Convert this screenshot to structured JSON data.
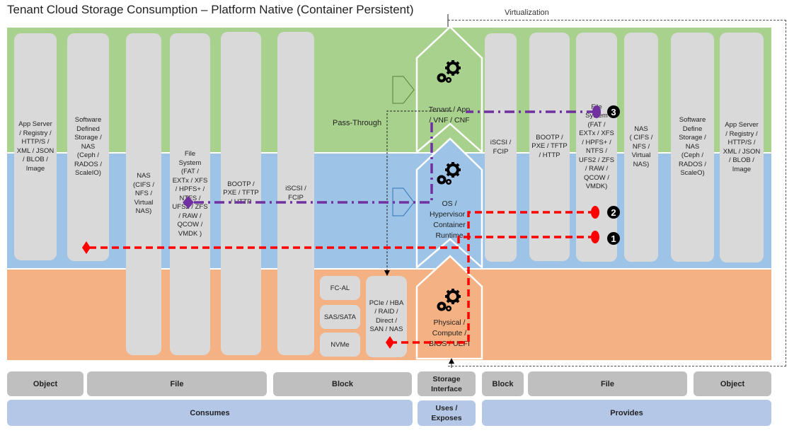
{
  "title": "Tenant Cloud Storage Consumption – Platform Native (Container Persistent)",
  "virtualization_label": "Virtualization",
  "pass_through_label": "Pass-Through",
  "colors": {
    "tenant_layer": "#a9d18e",
    "os_layer": "#9dc3e6",
    "physical_layer": "#f4b183",
    "column": "#d9d9d9",
    "category_button": "#bfbfbf",
    "role_button": "#b4c7e7",
    "path_red": "#ff0000",
    "path_purple": "#7030a0"
  },
  "left_columns": [
    {
      "label": "App Server\n/ Registry /\nHTTP/S /\nXML / JSON\n/ BLOB /\nImage"
    },
    {
      "label": "Software\nDefined\nStorage /\nNAS\n(Ceph /\nRADOS /\nScaleIO)"
    },
    {
      "label": "NAS\n(CIFS /\nNFS /\nVirtual\nNAS)"
    },
    {
      "label": "File\nSystem\n(FAT /\nEXTx / XFS\n/ HPFS+ /\nNTFS /\nUFS2 / ZFS\n/ RAW /\nQCOW /\nVMDK )"
    },
    {
      "label": "BOOTP /\nPXE / TFTP\n/ HTTP"
    },
    {
      "label": "iSCSI /\nFCIP"
    }
  ],
  "physical_interfaces": [
    {
      "label": "FC-AL"
    },
    {
      "label": "SAS/SATA"
    },
    {
      "label": "NVMe"
    }
  ],
  "physical_bus": {
    "label": "PCIe / HBA\n/ RAID /\nDirect /\nSAN / NAS"
  },
  "stack": [
    {
      "label": "Tenant / App\n/ VNF / CNF",
      "icon": "gears-icon"
    },
    {
      "label": "OS /\nHypervisor /\nContainer\nRuntime",
      "icon": "gears-icon"
    },
    {
      "label": "Physical /\nCompute /\nBIOS / UEFI",
      "icon": "gears-icon"
    }
  ],
  "right_columns": [
    {
      "label": "iSCSI /\nFCIP"
    },
    {
      "label": "BOOTP /\nPXE / TFTP\n/ HTTP"
    },
    {
      "label": "File\nSystem\n(FAT /\nEXTx / XFS\n/ HPFS+ /\nNTFS /\nUFS2 / ZFS\n/ RAW /\nQCOW /\nVMDK)"
    },
    {
      "label": "NAS\n( CIFS /\nNFS /\nVirtual\nNAS)"
    },
    {
      "label": "Software\nDefine\nStorage /\nNAS\n(Ceph /\nRADOS /\nScaleO)"
    },
    {
      "label": "App Server\n/ Registry /\nHTTP/S /\nXML / JSON\n/ BLOB /\nImage"
    }
  ],
  "paths": [
    {
      "number": "1",
      "color": "red",
      "style": "dashed"
    },
    {
      "number": "2",
      "color": "red",
      "style": "dashed"
    },
    {
      "number": "3",
      "color": "purple",
      "style": "dash-dot"
    }
  ],
  "bottom_categories": {
    "left": [
      "Object",
      "File",
      "Block"
    ],
    "center": "Storage\nInterface",
    "right": [
      "Block",
      "File",
      "Object"
    ]
  },
  "bottom_roles": {
    "left": "Consumes",
    "center": "Uses /\nExposes",
    "right": "Provides"
  }
}
